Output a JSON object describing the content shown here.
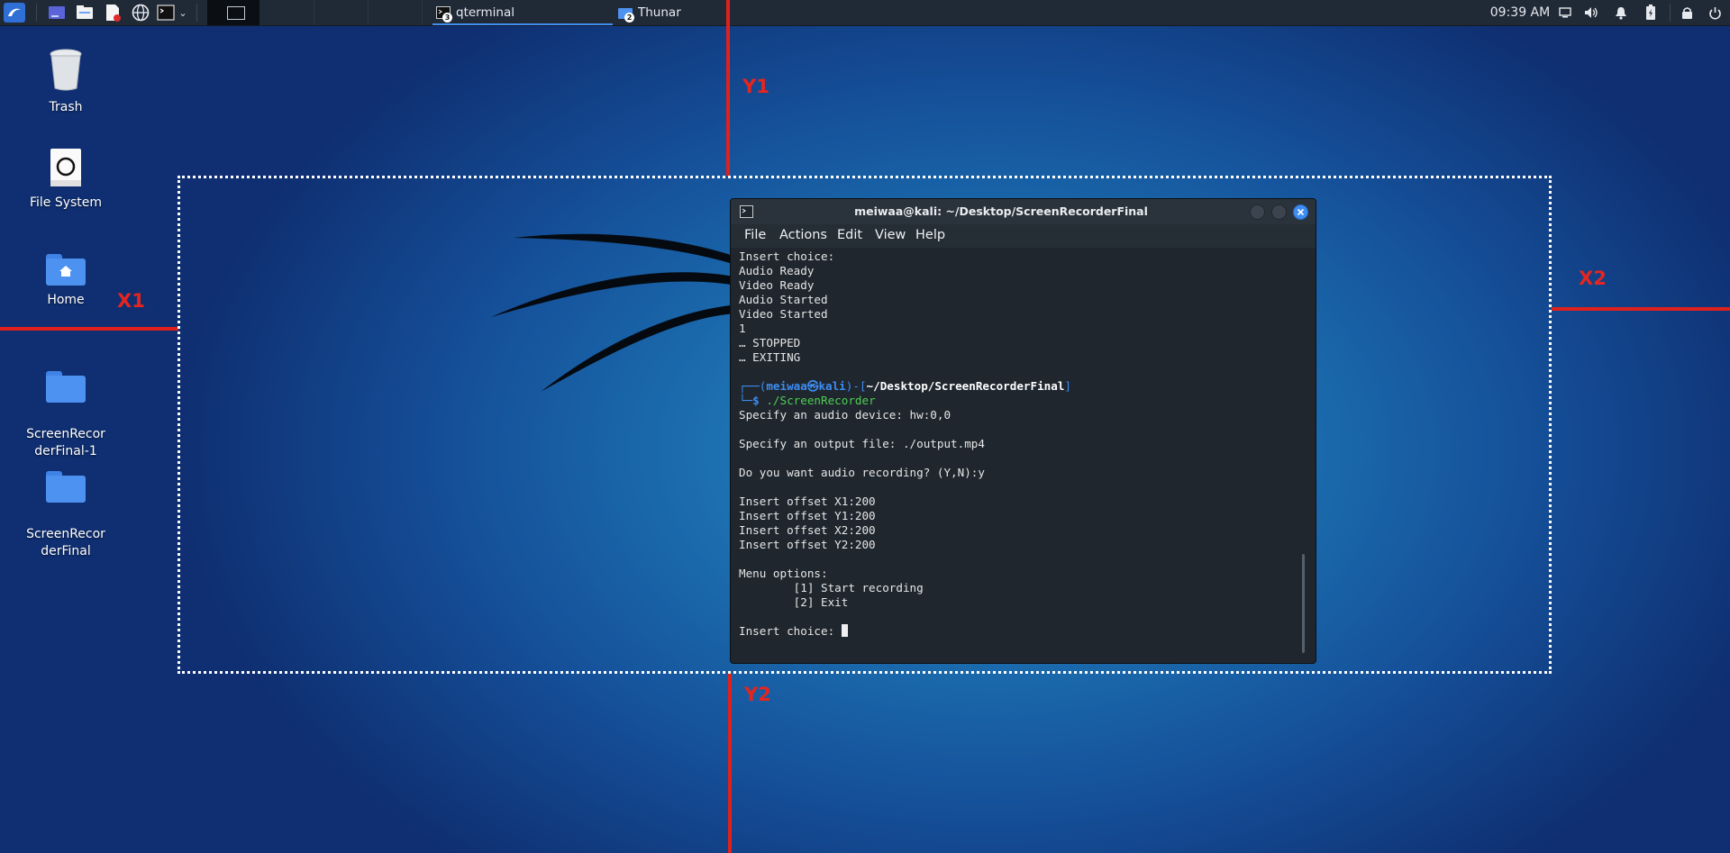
{
  "taskbar": {
    "tasks": [
      {
        "label": "qterminal",
        "badge": "3"
      },
      {
        "label": "Thunar",
        "badge": "2"
      }
    ],
    "clock": "09:39 AM",
    "launcher_icons": [
      "kali-menu-icon",
      "show-desktop-icon",
      "file-manager-icon",
      "text-editor-icon",
      "web-browser-icon",
      "terminal-icon",
      "chevron-down-icon"
    ]
  },
  "desktop": {
    "icons": [
      {
        "label": "Trash"
      },
      {
        "label": "File System"
      },
      {
        "label": "Home"
      },
      {
        "label": "ScreenRecor\nderFinal-1"
      },
      {
        "label": "ScreenRecor\nderFinal"
      }
    ]
  },
  "annotations": {
    "x1": "X1",
    "x2": "X2",
    "y1": "Y1",
    "y2": "Y2"
  },
  "terminal": {
    "title": "meiwaa@kali: ~/Desktop/ScreenRecorderFinal",
    "menu": [
      "File",
      "Actions",
      "Edit",
      "View",
      "Help"
    ],
    "lines_before": [
      "Insert choice:",
      "Audio Ready",
      "Video Ready",
      "Audio Started",
      "Video Started",
      "1",
      "… STOPPED",
      "… EXITING",
      ""
    ],
    "prompt": {
      "user": "meiwaa",
      "at": "㉿",
      "host": "kali",
      "path": "~/Desktop/ScreenRecorderFinal",
      "command": "./ScreenRecorder"
    },
    "lines_after": [
      "Specify an audio device: hw:0,0",
      "",
      "Specify an output file: ./output.mp4",
      "",
      "Do you want audio recording? (Y,N):y",
      "",
      "Insert offset X1:200",
      "Insert offset Y1:200",
      "Insert offset X2:200",
      "Insert offset Y2:200",
      "",
      "Menu options:",
      "        [1] Start recording",
      "        [2] Exit",
      ""
    ],
    "last_line": "Insert choice: "
  },
  "colors": {
    "prompt_blue": "#3d8df2",
    "prompt_green": "#4fcf52",
    "annotation_red": "#e0201c"
  }
}
